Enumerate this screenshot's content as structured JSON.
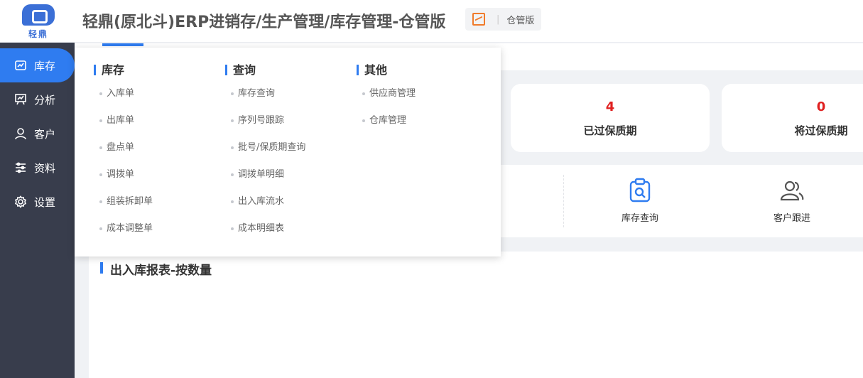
{
  "header": {
    "logo_text": "轻鼎",
    "title": "轻鼎(原北斗)ERP进销存/生产管理/库存管理-仓管版",
    "edition_label": "仓管版"
  },
  "sidebar": {
    "items": [
      {
        "label": "库存",
        "icon": "inventory-icon",
        "active": true
      },
      {
        "label": "分析",
        "icon": "analysis-icon"
      },
      {
        "label": "客户",
        "icon": "user-icon"
      },
      {
        "label": "资料",
        "icon": "sliders-icon"
      },
      {
        "label": "设置",
        "icon": "gear-icon"
      }
    ]
  },
  "stats": [
    {
      "value": "4",
      "label": "已过保质期"
    },
    {
      "value": "0",
      "label": "将过保质期"
    }
  ],
  "shortcuts": [
    {
      "label": "库存查询",
      "icon": "clipboard-search-icon"
    },
    {
      "label": "客户跟进",
      "icon": "users-icon"
    }
  ],
  "report": {
    "title": "出入库报表-按数量"
  },
  "dropdown": {
    "columns": [
      {
        "title": "库存",
        "items": [
          "入库单",
          "出库单",
          "盘点单",
          "调拨单",
          "组装拆卸单",
          "成本调整单"
        ]
      },
      {
        "title": "查询",
        "items": [
          "库存查询",
          "序列号跟踪",
          "批号/保质期查询",
          "调拨单明细",
          "出入库流水",
          "成本明细表"
        ]
      },
      {
        "title": "其他",
        "items": [
          "供应商管理",
          "仓库管理"
        ]
      }
    ]
  },
  "colors": {
    "accent": "#2f7cf0",
    "sidebar_bg": "#383d4c",
    "alert": "#e02020"
  }
}
